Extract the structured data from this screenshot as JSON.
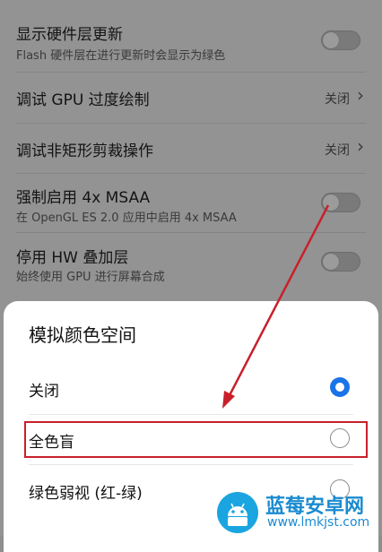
{
  "settings": [
    {
      "title": "显示硬件层更新",
      "subtitle": "Flash 硬件层在进行更新时会显示为绿色",
      "control": "toggle",
      "enabled": false
    },
    {
      "title": "调试 GPU 过度绘制",
      "value": "关闭",
      "control": "chevron"
    },
    {
      "title": "调试非矩形剪裁操作",
      "value": "关闭",
      "control": "chevron"
    },
    {
      "title": "强制启用 4x MSAA",
      "subtitle": "在 OpenGL ES 2.0 应用中启用 4x MSAA",
      "control": "toggle",
      "enabled": false
    },
    {
      "title": "停用 HW 叠加层",
      "subtitle": "始终使用 GPU 进行屏幕合成",
      "control": "toggle",
      "enabled": false
    }
  ],
  "dialog": {
    "title": "模拟颜色空间",
    "options": [
      {
        "label": "关闭",
        "selected": true
      },
      {
        "label": "全色盲",
        "selected": false
      },
      {
        "label": "绿色弱视 (红-绿)",
        "selected": false
      }
    ]
  },
  "watermark": {
    "title": "蓝莓安卓网",
    "url": "www.lmkjst.com"
  },
  "colors": {
    "accent": "#1a73e8",
    "highlight": "#c8202a",
    "watermark": "#1a8bd0"
  }
}
